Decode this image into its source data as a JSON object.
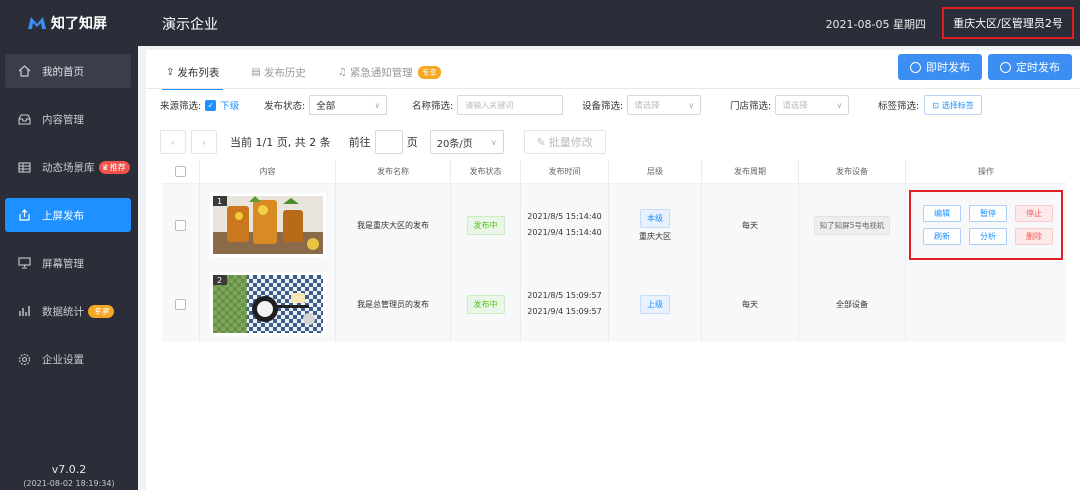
{
  "app": {
    "logo_text": "知了知屏",
    "version": "v7.0.2",
    "build": "(2021-08-02 18:19:34)"
  },
  "sidebar": {
    "items": [
      {
        "label": "我的首页"
      },
      {
        "label": "内容管理"
      },
      {
        "label": "动态场景库",
        "badge": "推荐"
      },
      {
        "label": "上屏发布"
      },
      {
        "label": "屏幕管理"
      },
      {
        "label": "数据统计",
        "badge": "专享"
      },
      {
        "label": "企业设置"
      }
    ]
  },
  "header": {
    "company": "演示企业",
    "datetime": "2021-08-05 星期四",
    "user": "重庆大区/区管理员2号"
  },
  "tabs": [
    {
      "label": "发布列表"
    },
    {
      "label": "发布历史"
    },
    {
      "label": "紧急通知管理",
      "badge": "专享"
    }
  ],
  "actions": {
    "publish_now": "即时发布",
    "publish_timed": "定时发布"
  },
  "filters": {
    "source_label": "来源筛选:",
    "source_option": "下级",
    "status_label": "发布状态:",
    "status_value": "全部",
    "name_label": "名称筛选:",
    "name_placeholder": "请输入关键词",
    "device_label": "设备筛选:",
    "device_placeholder": "请选择",
    "store_label": "门店筛选:",
    "store_placeholder": "请选择",
    "tag_label": "标签筛选:",
    "tag_button": "选择标签"
  },
  "pager": {
    "prev": "‹",
    "next": "›",
    "info": "当前 1/1 页, 共 2 条",
    "goto_label": "前往",
    "page_unit": "页",
    "page_size": "20条/页",
    "batch_edit": "批量修改"
  },
  "table": {
    "headers": [
      "内容",
      "发布名称",
      "发布状态",
      "发布时间",
      "层级",
      "发布周期",
      "发布设备",
      "操作"
    ],
    "rows": [
      {
        "index": "1",
        "name": "我是重庆大区的发布",
        "status": "发布中",
        "time_start": "2021/8/5 15:14:40",
        "time_end": "2021/9/4 15:14:40",
        "level": "本级",
        "level_sub": "重庆大区",
        "cycle": "每天",
        "device": "知了知屏5号电视机",
        "ops": [
          "编辑",
          "暂停",
          "停止",
          "刷新",
          "分析",
          "删除"
        ]
      },
      {
        "index": "2",
        "name": "我是总管理员的发布",
        "status": "发布中",
        "time_start": "2021/8/5 15:09:57",
        "time_end": "2021/9/4 15:09:57",
        "level": "上级",
        "cycle": "每天",
        "device": "全部设备"
      }
    ]
  },
  "colors": {
    "sidebar_bg": "#2b2e38",
    "accent": "#1e90ff",
    "highlight_box": "#e02020"
  }
}
